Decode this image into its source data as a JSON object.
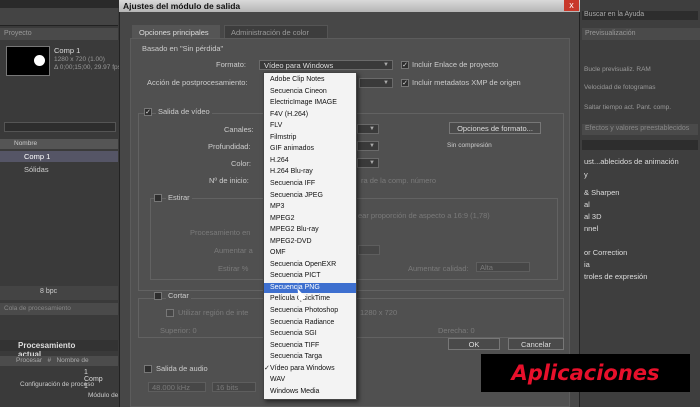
{
  "app": {
    "project_tab": "Proyecto",
    "comp": {
      "name": "Comp 1",
      "info1": "1280 x 720  (1.00)",
      "info2": "Δ 0;00;15;00, 29.97 fps"
    },
    "list_header": "Nombre",
    "rows": [
      "Comp 1",
      "Sólidas"
    ],
    "bpc": "8 bpc",
    "render_tab": "Cola de procesamiento",
    "render_title": "Procesamiento actual",
    "render_cols": [
      "Procesar",
      "#",
      "Nombre de"
    ],
    "render_row_num": "1",
    "render_row_name": "Comp 1",
    "render_sub1": "Configuración de proceso",
    "render_sub2": "Módulo de salida",
    "right": {
      "search": "Buscar en la Ayuda",
      "tab": "Previsualización",
      "lines": [
        "Bucle previsualiz. RAM",
        "Velocidad de fotogramas",
        "Saltar tiempo act.  Pant. comp."
      ],
      "effects_tab": "Efectos y valores preestablecidos",
      "items": [
        "ust...ablecidos de animación",
        "y",
        "& Sharpen",
        "al",
        "al 3D",
        "nnel",
        "or Correction",
        "ia",
        "troles de expresión"
      ]
    }
  },
  "dialog": {
    "title": "Ajustes del módulo de salida",
    "close": "x",
    "tabs": [
      "Opciones principales",
      "Administración de color"
    ],
    "based_on": "Basado en \"Sin pérdida\"",
    "format_label": "Formato:",
    "format_value": "Vídeo para Windows",
    "include_link": "Incluir Enlace de proyecto",
    "post_label": "Acción de postprocesamiento:",
    "include_xmp": "Incluir metadatos XMP de origen",
    "video_out": "Salida de vídeo",
    "channels": "Canales:",
    "depth": "Profundidad:",
    "color": "Color:",
    "start": "Nº de inicio:",
    "start_hint": "ra de la comp. número",
    "format_opts": "Opciones de formato...",
    "compression": "Sin compresión",
    "stretch": "Estirar",
    "aspect": "ear proporción de aspecto a 16:9 (1,78)",
    "proc_label": "Procesamiento en",
    "stretch_hint": "Aumentar a",
    "quality_label": "Aumentar calidad:",
    "quality_value": "Alta",
    "stretch_pct": "Estirar %",
    "cut": "Cortar",
    "roi": "Utilizar región de inte",
    "final": "1280 x 720",
    "top": "Superior: 0",
    "right_label": "Derecha: 0",
    "audio_out": "Salida de audio",
    "hz": "48.000 kHz",
    "bits": "16 bits",
    "ok": "OK",
    "cancel": "Cancelar"
  },
  "dropdown": {
    "items": [
      "Adobe Clip Notes",
      "Secuencia Cineon",
      "ElectricImage IMAGE",
      "F4V (H.264)",
      "FLV",
      "Filmstrip",
      "GIF animados",
      "H.264",
      "H.264 Blu-ray",
      "Secuencia IFF",
      "Secuencia JPEG",
      "MP3",
      "MPEG2",
      "MPEG2 Blu-ray",
      "MPEG2-DVD",
      "OMF",
      "Secuencia OpenEXR",
      "Secuencia PICT",
      "Secuencia PNG",
      "Película QuickTime",
      "Secuencia Photoshop",
      "Secuencia Radiance",
      "Secuencia SGI",
      "Secuencia TIFF",
      "Secuencia Targa",
      "Vídeo para Windows",
      "WAV",
      "Windows Media"
    ],
    "highlighted_index": 18,
    "checked_index": 25
  },
  "watermark": "Aplicaciones"
}
